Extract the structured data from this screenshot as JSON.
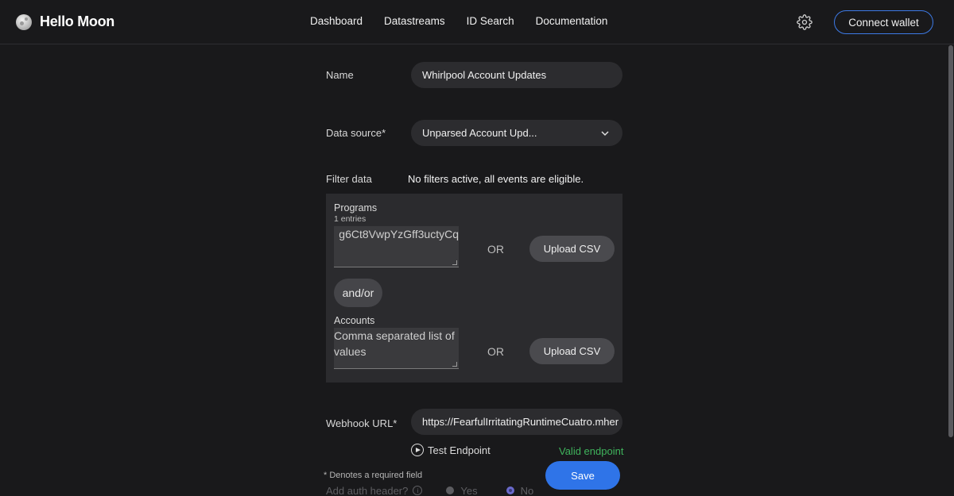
{
  "brand": {
    "name": "Hello Moon"
  },
  "nav": {
    "items": [
      "Dashboard",
      "Datastreams",
      "ID Search",
      "Documentation"
    ]
  },
  "header": {
    "connect_label": "Connect wallet"
  },
  "form": {
    "name": {
      "label": "Name",
      "value": "Whirlpool Account Updates"
    },
    "data_source": {
      "label": "Data source*",
      "value": "Unparsed Account Upd..."
    },
    "filter": {
      "label": "Filter data",
      "status": "No filters active, all events are eligible.",
      "programs": {
        "label": "Programs",
        "count": "1 entries",
        "value": "g6Ct8VwpYzGff3uctyCq"
      },
      "or_label": "OR",
      "upload_label": "Upload CSV",
      "andor_label": "and/or",
      "accounts": {
        "label": "Accounts",
        "placeholder": "Comma separated list of values"
      }
    },
    "webhook": {
      "label": "Webhook URL*",
      "value": "https://FearfulIrritatingRuntimeCuatro.mher",
      "test_label": "Test Endpoint",
      "valid_text": "Valid endpoint"
    },
    "required_note": "* Denotes a required field",
    "save_label": "Save",
    "auth_header": {
      "label": "Add auth header?",
      "options": [
        "Yes",
        "No"
      ],
      "selected": "No"
    }
  },
  "colors": {
    "background": "#19191b",
    "accent": "#2f74e8",
    "valid": "#3fb35c"
  }
}
